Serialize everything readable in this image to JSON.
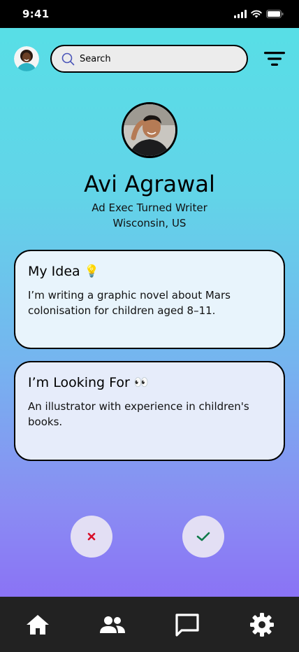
{
  "status_bar": {
    "time": "9:41"
  },
  "search": {
    "label": "Search"
  },
  "profile": {
    "name": "Avi Agrawal",
    "role": "Ad Exec Turned Writer",
    "location": "Wisconsin, US"
  },
  "cards": {
    "idea": {
      "title": "My Idea",
      "emoji": "💡",
      "body": "I’m writing a graphic novel about Mars colonisation for children aged 8–11."
    },
    "looking": {
      "title": "I’m Looking For",
      "emoji": "👀",
      "body": "An illustrator with experience in children's books."
    }
  },
  "actions": {
    "reject_icon": "x-icon",
    "accept_icon": "check-icon",
    "reject_color": "#d8102a",
    "accept_color": "#0f7a4a"
  },
  "tabs": [
    "home-icon",
    "people-icon",
    "chat-icon",
    "settings-icon"
  ],
  "colors": {
    "gradient_top": "#56e0e6",
    "gradient_bottom": "#8b63f6",
    "tabbar": "#222222"
  }
}
